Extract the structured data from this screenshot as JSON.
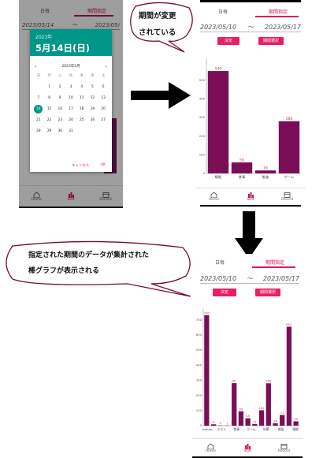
{
  "tabs": {
    "daily": "日毎",
    "period": "期間指定"
  },
  "dates": {
    "start": "2023/05/10",
    "tilde": "〜",
    "end": "2023/05/17",
    "old_start": "2023/05/14",
    "old_end": "2023/05/"
  },
  "buttons": {
    "decide": "決定",
    "select_period": "期間選択"
  },
  "nav": {
    "home": "Home",
    "stat": "Stat",
    "record": "Record"
  },
  "datepicker": {
    "year": "2023年",
    "selected_date": "5月14日(日)",
    "month_label": "2023年5月",
    "prev": "‹",
    "next": "›",
    "weekdays": [
      "日",
      "月",
      "火",
      "水",
      "木",
      "金",
      "土"
    ],
    "days": [
      "",
      "1",
      "2",
      "3",
      "4",
      "5",
      "6",
      "7",
      "8",
      "9",
      "10",
      "11",
      "12",
      "13",
      "14",
      "15",
      "16",
      "17",
      "18",
      "19",
      "20",
      "21",
      "22",
      "23",
      "24",
      "25",
      "26",
      "27",
      "28",
      "29",
      "30",
      "31",
      "",
      "",
      ""
    ],
    "cancel": "キャンセル",
    "ok": "OK"
  },
  "callouts": {
    "top_line1": "期間が変更",
    "top_line2": "されている",
    "bottom_line1": "指定された期間のデータが集計された",
    "bottom_line2": "棒グラフが表示される"
  },
  "colors": {
    "accent": "#e91e63",
    "bar": "#7b0f57",
    "teal": "#009688",
    "label_red": "#d32f2f"
  },
  "chart_data": [
    {
      "type": "bar",
      "categories": [
        "睡眠",
        "食事",
        "勉強",
        "ゲーム"
      ],
      "values": [
        549,
        59,
        16,
        280
      ],
      "ylim": [
        0,
        600
      ],
      "yticks": [
        0,
        100,
        200,
        300,
        400,
        500
      ],
      "grid": false
    },
    {
      "type": "bar",
      "categories": [
        "mobile",
        "",
        "テスト",
        "",
        "食事",
        "",
        "ゲーム",
        "",
        "休憩",
        "",
        "雑談",
        "",
        "睡眠"
      ],
      "values": [
        730,
        9,
        2,
        1,
        281,
        95,
        49,
        11,
        102,
        280,
        16,
        71,
        654,
        29
      ],
      "value_labels": [
        "730",
        "9",
        "2",
        "1",
        "281",
        "95",
        "49",
        "11",
        "102",
        "280",
        "16",
        "71",
        "654",
        "29"
      ],
      "ylim": [
        0,
        750
      ],
      "yticks": [
        0,
        100,
        200,
        300,
        400,
        500,
        600,
        700
      ],
      "grid": false
    }
  ]
}
